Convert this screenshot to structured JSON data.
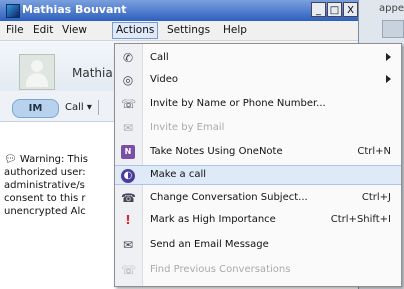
{
  "window": {
    "title": "Mathias Bouvant",
    "controls": {
      "minimize": "_",
      "maximize": "□",
      "close": "X"
    }
  },
  "background_fragment": "appe",
  "menubar": {
    "items": [
      {
        "label": "File"
      },
      {
        "label": "Edit"
      },
      {
        "label": "View"
      },
      {
        "label": "Actions"
      },
      {
        "label": "Settings"
      },
      {
        "label": "Help"
      }
    ],
    "active": "Actions"
  },
  "contact": {
    "name_visible": "Mathia"
  },
  "toolbar": {
    "im_label": "IM",
    "call_label": "Call",
    "call_dropdown": "▾"
  },
  "warning": {
    "icon": "speech-bubble-icon",
    "lines": [
      "Warning: This",
      "authorized user:",
      "administrative/s",
      "consent to this r",
      "unencrypted Alc"
    ]
  },
  "actions_menu": {
    "items": [
      {
        "label": "Call",
        "icon": "phone-icon",
        "submenu": true,
        "enabled": true
      },
      {
        "label": "Video",
        "icon": "webcam-icon",
        "submenu": true,
        "enabled": true
      },
      {
        "label": "Invite by Name or Phone Number...",
        "icon": "invite-icon",
        "enabled": true
      },
      {
        "label": "Invite by Email",
        "icon": "email-icon",
        "enabled": false
      },
      {
        "label": "Take Notes Using OneNote",
        "shortcut": "Ctrl+N",
        "icon": "onenote-icon",
        "enabled": true
      },
      {
        "label": "Make a call",
        "icon": "make-call-icon",
        "enabled": true,
        "highlighted": true
      },
      {
        "label": "Change Conversation Subject...",
        "shortcut": "Ctrl+J",
        "icon": "subject-icon",
        "enabled": true
      },
      {
        "label": "Mark as High Importance",
        "shortcut": "Ctrl+Shift+I",
        "icon": "exclamation-icon",
        "enabled": true
      },
      {
        "label": "Send an Email Message",
        "icon": "envelope-icon",
        "enabled": true
      },
      {
        "label": "Find Previous Conversations",
        "icon": "history-icon",
        "enabled": false
      }
    ]
  }
}
